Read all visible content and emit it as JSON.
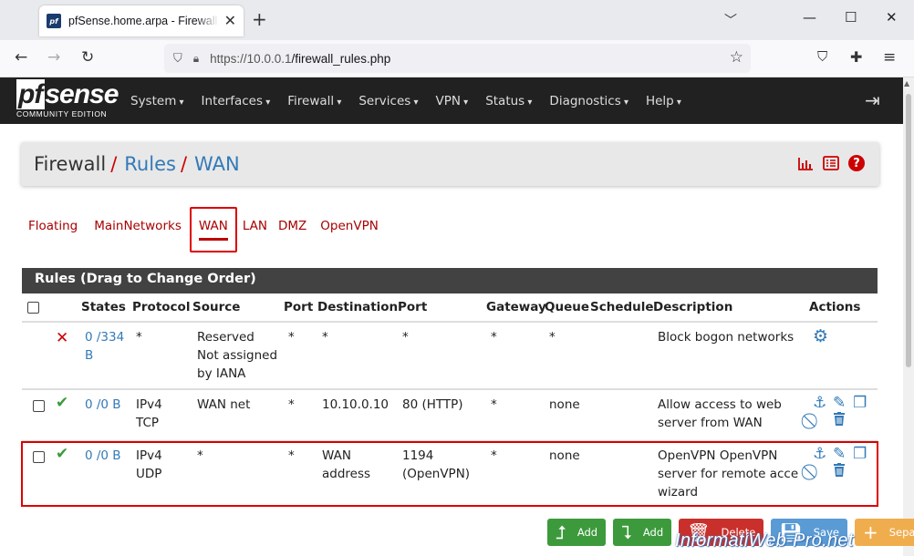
{
  "browser": {
    "tab_title": "pfSense.home.arpa - Firewall: Rules: WAN",
    "tab_close": "✕",
    "new_tab": "+",
    "url_host": "https://10.0.0.1",
    "url_path": "/firewall_rules.php"
  },
  "brand": {
    "logo_prefix": "pf",
    "logo_suffix": "sense",
    "edition": "COMMUNITY EDITION"
  },
  "menu": [
    "System",
    "Interfaces",
    "Firewall",
    "Services",
    "VPN",
    "Status",
    "Diagnostics",
    "Help"
  ],
  "breadcrumb": {
    "root": "Firewall",
    "sep": "/",
    "level1": "Rules",
    "level2": "WAN"
  },
  "interface_tabs": {
    "floating": "Floating",
    "mainnetworks": "MainNetworks",
    "wan": "WAN",
    "lan": "LAN",
    "dmz": "DMZ",
    "openvpn": "OpenVPN"
  },
  "table": {
    "title": "Rules (Drag to Change Order)",
    "headers": {
      "states": "States",
      "protocol": "Protocol",
      "source": "Source",
      "port": "Port",
      "destination": "Destination",
      "port2": "Port",
      "gateway": "Gateway",
      "queue": "Queue",
      "schedule": "Schedule",
      "description": "Description",
      "actions": "Actions"
    },
    "rows": [
      {
        "states": [
          "0 /334",
          "B"
        ],
        "protocol": [
          "*"
        ],
        "source": [
          "Reserved",
          "Not assigned",
          "by IANA"
        ],
        "port": "*",
        "destination": [
          "*"
        ],
        "port2": [
          "*"
        ],
        "gateway": "*",
        "queue": "*",
        "schedule": "",
        "description": [
          "Block bogon networks"
        ]
      },
      {
        "states": [
          "0 /0 B"
        ],
        "protocol": [
          "IPv4",
          "TCP"
        ],
        "source": [
          "WAN net"
        ],
        "port": "*",
        "destination": [
          "10.10.0.10"
        ],
        "port2": [
          "80 (HTTP)"
        ],
        "gateway": "*",
        "queue": "none",
        "schedule": "",
        "description": [
          "Allow access to web",
          "server from WAN"
        ]
      },
      {
        "states": [
          "0 /0 B"
        ],
        "protocol": [
          "IPv4",
          "UDP"
        ],
        "source": [
          "*"
        ],
        "port": "*",
        "destination": [
          "WAN",
          "address"
        ],
        "port2": [
          "1194",
          "(OpenVPN)"
        ],
        "gateway": "*",
        "queue": "none",
        "schedule": "",
        "description": [
          "OpenVPN OpenVPN",
          "server for remote acce",
          "wizard"
        ]
      }
    ]
  },
  "buttons": {
    "add_top": "Add",
    "add_bottom": "Add",
    "delete": "Delete",
    "save": "Save",
    "separator": "Separator"
  },
  "watermark": "InformatiWeb-Pro.net",
  "colors": {
    "accent_red": "#c00000",
    "link_blue": "#337ab7",
    "pass_green": "#3c9a3c",
    "header_dark": "#212121"
  }
}
